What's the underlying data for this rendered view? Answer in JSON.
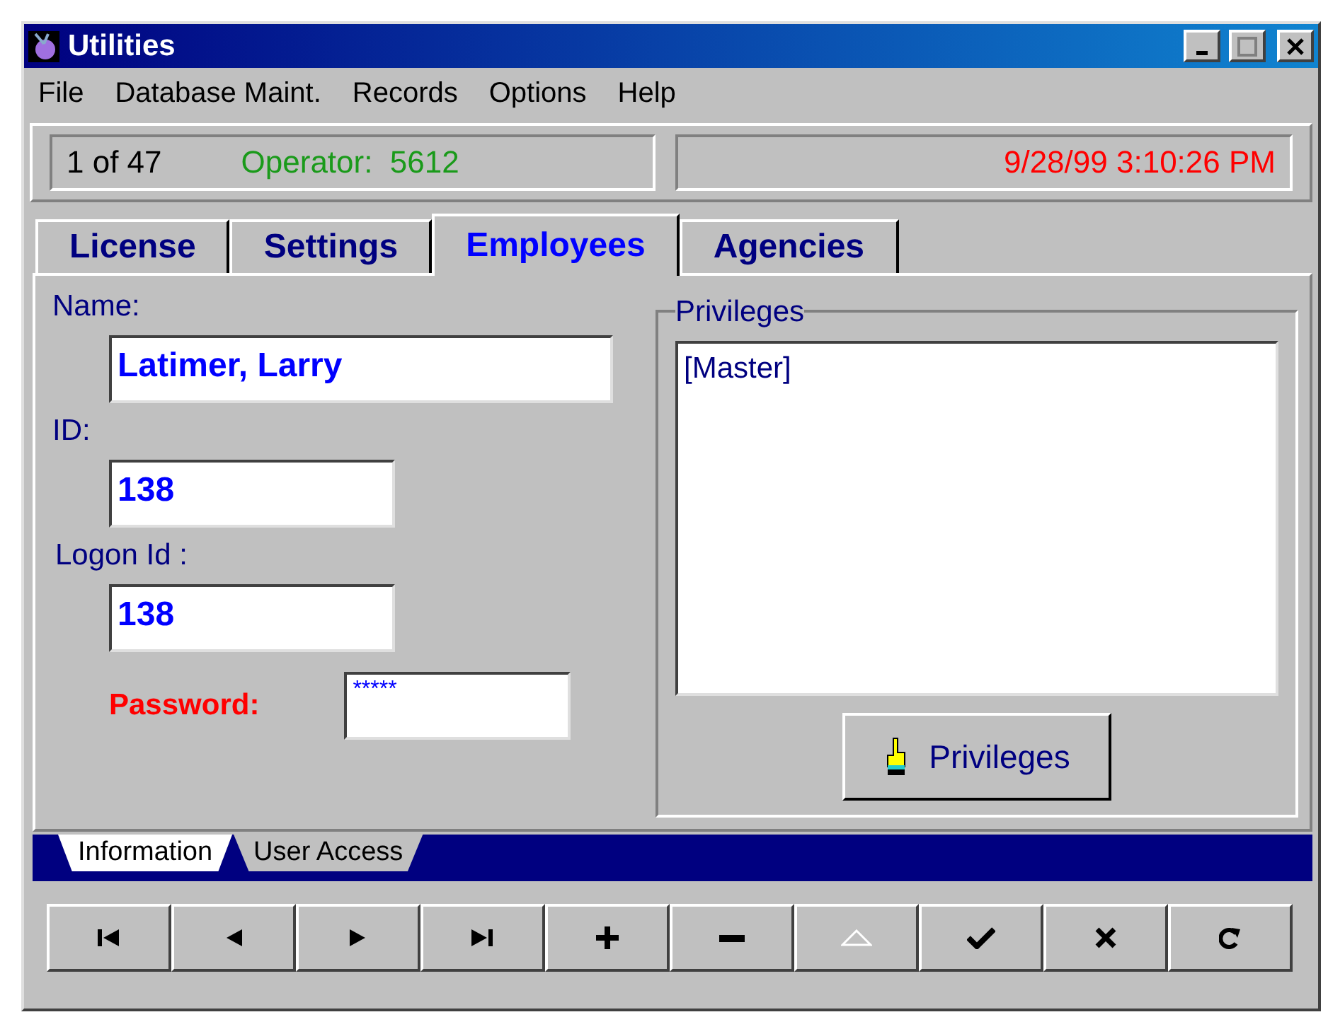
{
  "window": {
    "title": "Utilities"
  },
  "menu": [
    "File",
    "Database Maint.",
    "Records",
    "Options",
    "Help"
  ],
  "status": {
    "record": "1 of 47",
    "operator": "Operator:  5612",
    "datetime": "9/28/99 3:10:26 PM"
  },
  "tabs": [
    {
      "label": "License",
      "selected": false
    },
    {
      "label": "Settings",
      "selected": false
    },
    {
      "label": "Employees",
      "selected": true
    },
    {
      "label": "Agencies",
      "selected": false
    }
  ],
  "form": {
    "name_label": "Name:",
    "name": "Latimer, Larry",
    "id_label": "ID:",
    "id": "138",
    "logon_label": "Logon Id :",
    "logon": "138",
    "password_label": "Password:",
    "password": "*****"
  },
  "privileges": {
    "title": "Privileges",
    "items": [
      "[Master]"
    ],
    "button": "Privileges"
  },
  "subtabs": [
    {
      "label": "Information",
      "selected": true
    },
    {
      "label": "User Access",
      "selected": false
    }
  ],
  "nav_buttons": [
    {
      "kind": "first",
      "disabled": false
    },
    {
      "kind": "prev",
      "disabled": false
    },
    {
      "kind": "next",
      "disabled": false
    },
    {
      "kind": "last",
      "disabled": false
    },
    {
      "kind": "add",
      "disabled": false
    },
    {
      "kind": "delete",
      "disabled": false
    },
    {
      "kind": "edit",
      "disabled": true
    },
    {
      "kind": "save",
      "disabled": false
    },
    {
      "kind": "cancel",
      "disabled": false
    },
    {
      "kind": "refresh",
      "disabled": false
    }
  ]
}
